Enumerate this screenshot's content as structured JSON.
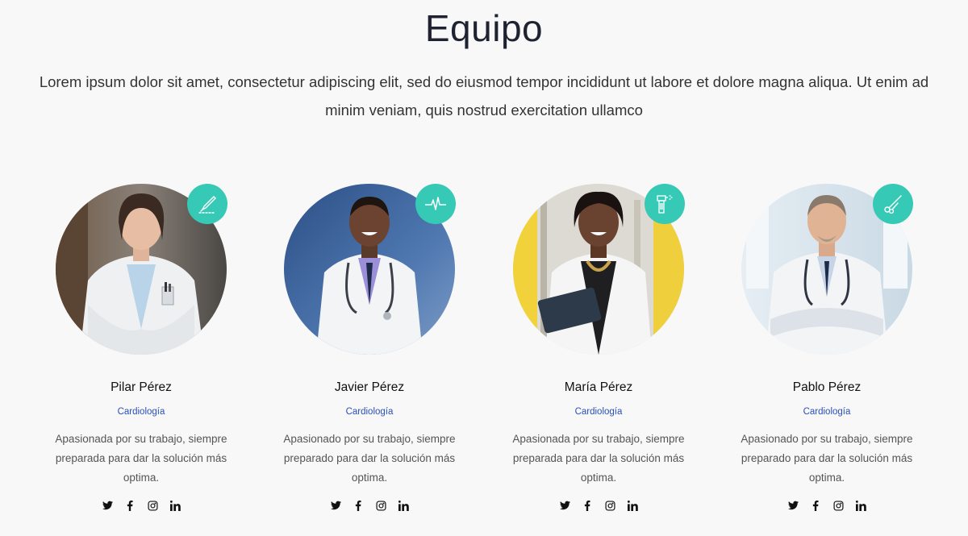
{
  "section": {
    "title": "Equipo",
    "intro": "Lorem ipsum dolor sit amet, consectetur adipiscing elit, sed do eiusmod tempor incididunt ut labore et dolore magna aliqua. Ut enim ad minim veniam, quis nostrud exercitation ullamco"
  },
  "team": [
    {
      "name": "Pilar Pérez",
      "specialty": "Cardiología",
      "description": "Apasionada por su trabajo, siempre preparada para dar la solución más optima.",
      "badge_icon": "scalpel-icon"
    },
    {
      "name": "Javier Pérez",
      "specialty": "Cardiología",
      "description": "Apasionado por su trabajo, siempre preparado para dar la solución más optima.",
      "badge_icon": "heartbeat-icon"
    },
    {
      "name": "María Pérez",
      "specialty": "Cardiología",
      "description": "Apasionada por su trabajo, siempre preparada para dar la solución más optima.",
      "badge_icon": "spray-bottle-icon"
    },
    {
      "name": "Pablo Pérez",
      "specialty": "Cardiología",
      "description": "Apasionado por su trabajo, siempre preparado para dar la solución más optima.",
      "badge_icon": "scissors-icon"
    }
  ],
  "social_icons": [
    "twitter-icon",
    "facebook-icon",
    "instagram-icon",
    "linkedin-icon"
  ],
  "colors": {
    "accent": "#35c9b6",
    "specialty_link": "#2a4fb7",
    "background": "#f8f8f9"
  }
}
